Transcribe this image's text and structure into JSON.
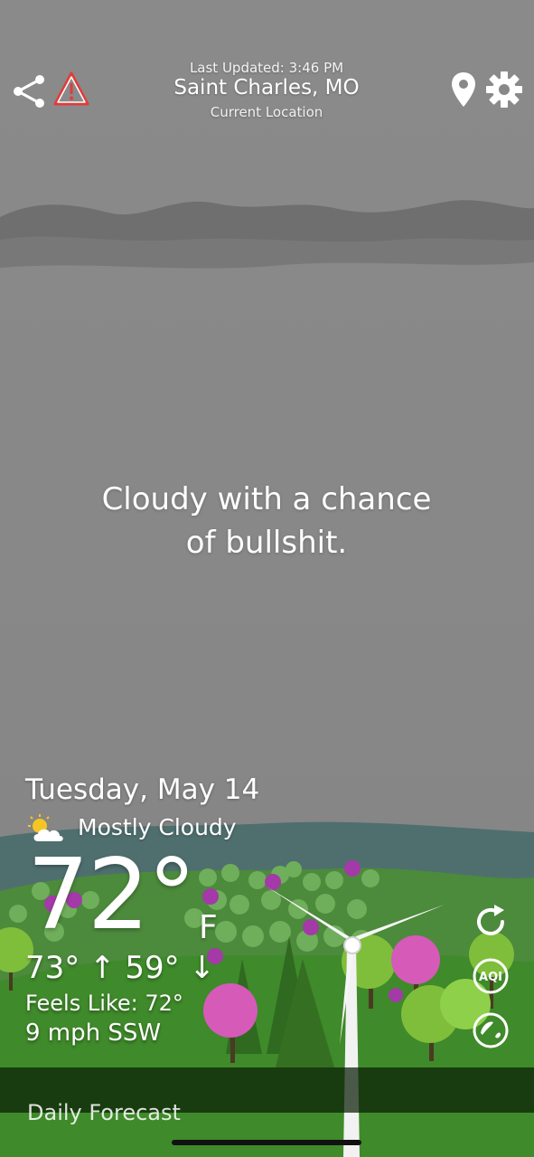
{
  "header": {
    "last_updated": "Last Updated: 3:46 PM",
    "location": "Saint Charles, MO",
    "location_sub": "Current Location"
  },
  "quip": {
    "line1": "Cloudy with a chance",
    "line2": "of bullshit."
  },
  "current": {
    "date": "Tuesday, May 14",
    "condition": "Mostly Cloudy",
    "condition_icon": "partly-cloudy-icon",
    "temperature": "72°",
    "unit": "F",
    "high": "73° ↑",
    "low": "59° ↓",
    "feels_like": "Feels Like: 72°",
    "wind": "9 mph SSW"
  },
  "side_buttons": {
    "aqi_label": "AQI"
  },
  "bottom": {
    "peek_text": "Daily Forecast"
  },
  "colors": {
    "sky": "#888888",
    "cloud_band": "#6f6f6f",
    "hills": "#4f6f6f",
    "grass": "#3f8a2a",
    "pink_tree": "#d65ab8",
    "green_tree": "#7fbe3a"
  }
}
